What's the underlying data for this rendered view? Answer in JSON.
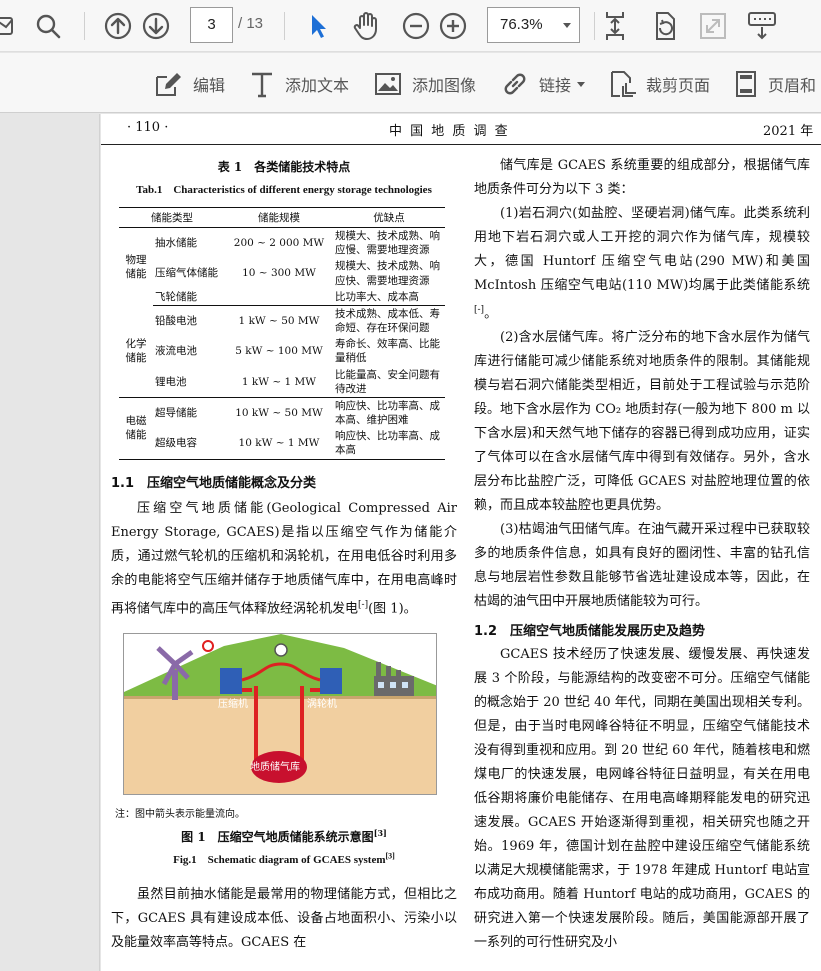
{
  "viewer": {
    "page_current": "3",
    "page_total": "/ 13",
    "zoom": "76.3%"
  },
  "edit_toolbar": {
    "edit": "编辑",
    "add_text": "添加文本",
    "add_image": "添加图像",
    "link": "链接",
    "crop": "裁剪页面",
    "header_footer": "页眉和"
  },
  "page_header": {
    "page_no": "· 110 ·",
    "journal": "中 国 地 质 调 查",
    "year": "2021 年"
  },
  "table1": {
    "title_cn": "表 1　各类储能技术特点",
    "title_en": "Tab.1　Characteristics of different energy storage technologies",
    "headers": [
      "储能类型",
      "储能规模",
      "优缺点"
    ],
    "groups": [
      {
        "category": "物理储能",
        "rows": [
          {
            "type": "抽水储能",
            "scale": "200 ~ 2 000 MW",
            "pros": "规模大、技术成熟、响应慢、需要地理资源"
          },
          {
            "type": "压缩气体储能",
            "scale": "10 ~ 300 MW",
            "pros": "规模大、技术成熟、响应快、需要地理资源"
          },
          {
            "type": "飞轮储能",
            "scale": "",
            "pros": "比功率大、成本高"
          }
        ]
      },
      {
        "category": "化学储能",
        "rows": [
          {
            "type": "铅酸电池",
            "scale": "1 kW ~ 50 MW",
            "pros": "技术成熟、成本低、寿命短、存在环保问题"
          },
          {
            "type": "液流电池",
            "scale": "5 kW ~ 100 MW",
            "pros": "寿命长、效率高、比能量稍低"
          },
          {
            "type": "锂电池",
            "scale": "1 kW ~ 1 MW",
            "pros": "比能量高、安全问题有待改进"
          }
        ]
      },
      {
        "category": "电磁储能",
        "rows": [
          {
            "type": "超导储能",
            "scale": "10 kW ~ 50 MW",
            "pros": "响应快、比功率高、成本高、维护困难"
          },
          {
            "type": "超级电容",
            "scale": "10 kW ~ 1 MW",
            "pros": "响应快、比功率高、成本高"
          }
        ]
      }
    ]
  },
  "section_1_1": {
    "title": "1.1　压缩空气地质储能概念及分类",
    "para": "压缩空气地质储能(Geological Compressed Air Energy Storage, GCAES)是指以压缩空气作为储能介质，通过燃气轮机的压缩机和涡轮机，在用电低谷时利用多余的电能将空气压缩并储存于地质储气库中，在用电高峰时再将储气库中的高压气体释放经涡轮机发电",
    "cite": "[-]",
    "para_tail": "(图 1)。"
  },
  "figure1": {
    "label_compressor": "压缩机",
    "label_turbine": "涡轮机",
    "label_storage": "地质储气库",
    "note": "注：图中箭头表示能量流向。",
    "caption_cn": "图 1　压缩空气地质储能系统示意图",
    "caption_cn_cite": "[3]",
    "caption_en": "Fig.1　Schematic diagram of GCAES system",
    "caption_en_cite": "[3]"
  },
  "left_bottom_para": "虽然目前抽水储能是最常用的物理储能方式，但相比之下，GCAES 具有建设成本低、设备占地面积小、污染小以及能量效率高等特点。GCAES 在",
  "right_col": {
    "p1": "储气库是 GCAES 系统重要的组成部分，根据储气库地质条件可分为以下 3 类：",
    "p2": "(1)岩石洞穴(如盐腔、坚硬岩洞)储气库。此类系统利用地下岩石洞穴或人工开挖的洞穴作为储气库，规模较大，德国 Huntorf 压缩空气电站(290 MW)和美国 McIntosh 压缩空气电站(110 MW)均属于此类储能系统",
    "p2_cite": "[-]",
    "p2_end": "。",
    "p3": "(2)含水层储气库。将广泛分布的地下含水层作为储气库进行储能可减少储能系统对地质条件的限制。其储能规模与岩石洞穴储能类型相近，目前处于工程试验与示范阶段。地下含水层作为 CO₂ 地质封存(一般为地下 800 m 以下含水层)和天然气地下储存的容器已得到成功应用，证实了气体可以在含水层储气库中得到有效储存。另外，含水层分布比盐腔广泛，可降低 GCAES 对盐腔地理位置的依赖，而且成本较盐腔也更具优势。",
    "p4": "(3)枯竭油气田储气库。在油气藏开采过程中已获取较多的地质条件信息，如具有良好的圈闭性、丰富的钻孔信息与地层岩性参数且能够节省选址建设成本等，因此，在枯竭的油气田中开展地质储能较为可行。",
    "sec_title": "1.2　压缩空气地质储能发展历史及趋势",
    "p5": "GCAES 技术经历了快速发展、缓慢发展、再快速发展 3 个阶段，与能源结构的改变密不可分。压缩空气储能的概念始于 20 世纪 40 年代，同期在美国出现相关专利。但是，由于当时电网峰谷特征不明显，压缩空气储能技术没有得到重视和应用。到 20 世纪 60 年代，随着核电和燃煤电厂的快速发展，电网峰谷特征日益明显，有关在用电低谷期将廉价电能储存、在用电高峰期释能发电的研究迅速发展。GCAES 开始逐渐得到重视，相关研究也随之开始。1969 年，德国计划在盐腔中建设压缩空气储能系统以满足大规模储能需求，于 1978 年建成 Huntorf 电站宣布成功商用。随着 Huntorf 电站的成功商用，GCAES 的研究进入第一个快速发展阶段。随后，美国能源部开展了一系列的可行性研究及小"
  }
}
